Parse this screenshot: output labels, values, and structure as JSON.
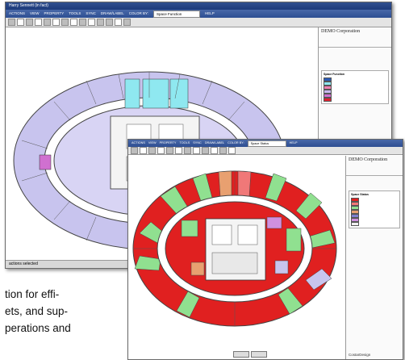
{
  "back_window": {
    "title": "Harry Sennett (in fact)",
    "menu": [
      "ACTIONS",
      "VIEW",
      "PROPERTY",
      "TOOLS",
      "SYNC",
      "DRAW/LABEL",
      "COLOR BY:",
      "HELP"
    ],
    "color_by_value": "Space Function",
    "company": "DEMO Corporation",
    "legend_title": "Space Function",
    "legend_items": [
      {
        "color": "#2b5bb5"
      },
      {
        "color": "#8fe8f0"
      },
      {
        "color": "#f080b0"
      },
      {
        "color": "#c8b8f0"
      },
      {
        "color": "#d070d0"
      },
      {
        "color": "#e02030"
      }
    ],
    "status": "actions selected"
  },
  "front_window": {
    "menu": [
      "ACTIONS",
      "VIEW",
      "PROPERTY",
      "TOOLS",
      "SYNC",
      "DRAW/LABEL",
      "COLOR BY:",
      "HELP"
    ],
    "color_by_value": "Space Status",
    "company": "DEMO Corporation",
    "legend_title": "Space Status",
    "legend_items": [
      {
        "color": "#e02020"
      },
      {
        "color": "#f07878"
      },
      {
        "color": "#90e090"
      },
      {
        "color": "#e8a070"
      },
      {
        "color": "#8080d0"
      },
      {
        "color": "#d090e0"
      },
      {
        "color": "#f0f0f0"
      }
    ],
    "sidebar_bottom": "CostarDesign"
  },
  "body_text": {
    "line1": "tion for effi-",
    "line2": "ets, and sup-",
    "line3": "perations and"
  }
}
